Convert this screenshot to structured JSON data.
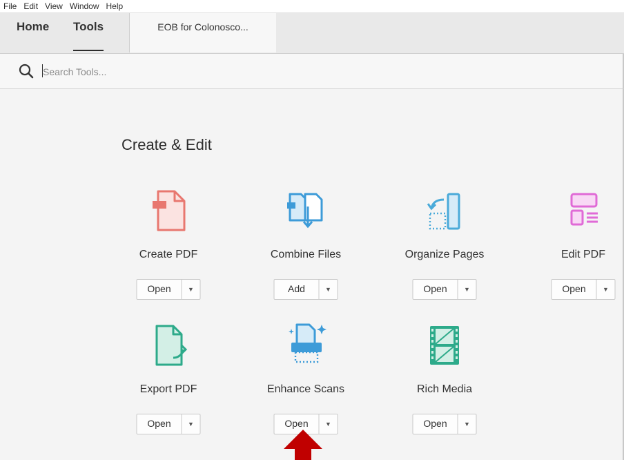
{
  "menu": [
    "File",
    "Edit",
    "View",
    "Window",
    "Help"
  ],
  "nav": {
    "home": "Home",
    "tools": "Tools",
    "doc_tab": "EOB for Colonosco..."
  },
  "search": {
    "placeholder": "Search Tools..."
  },
  "section": {
    "title": "Create & Edit"
  },
  "tools": [
    {
      "name": "Create PDF",
      "button": "Open",
      "icon": "create-pdf-icon",
      "color": "#e8776f"
    },
    {
      "name": "Combine Files",
      "button": "Add",
      "icon": "combine-files-icon",
      "color": "#3d9bd8"
    },
    {
      "name": "Organize Pages",
      "button": "Open",
      "icon": "organize-pages-icon",
      "color": "#4aaad9"
    },
    {
      "name": "Edit PDF",
      "button": "Open",
      "icon": "edit-pdf-icon",
      "color": "#e06ad6"
    },
    {
      "name": "Export PDF",
      "button": "Open",
      "icon": "export-pdf-icon",
      "color": "#2daa8a"
    },
    {
      "name": "Enhance Scans",
      "button": "Open",
      "icon": "enhance-scans-icon",
      "color": "#3d9bd8"
    },
    {
      "name": "Rich Media",
      "button": "Open",
      "icon": "rich-media-icon",
      "color": "#2daa8a"
    }
  ],
  "colors": {
    "annotation_arrow": "#c00000"
  }
}
